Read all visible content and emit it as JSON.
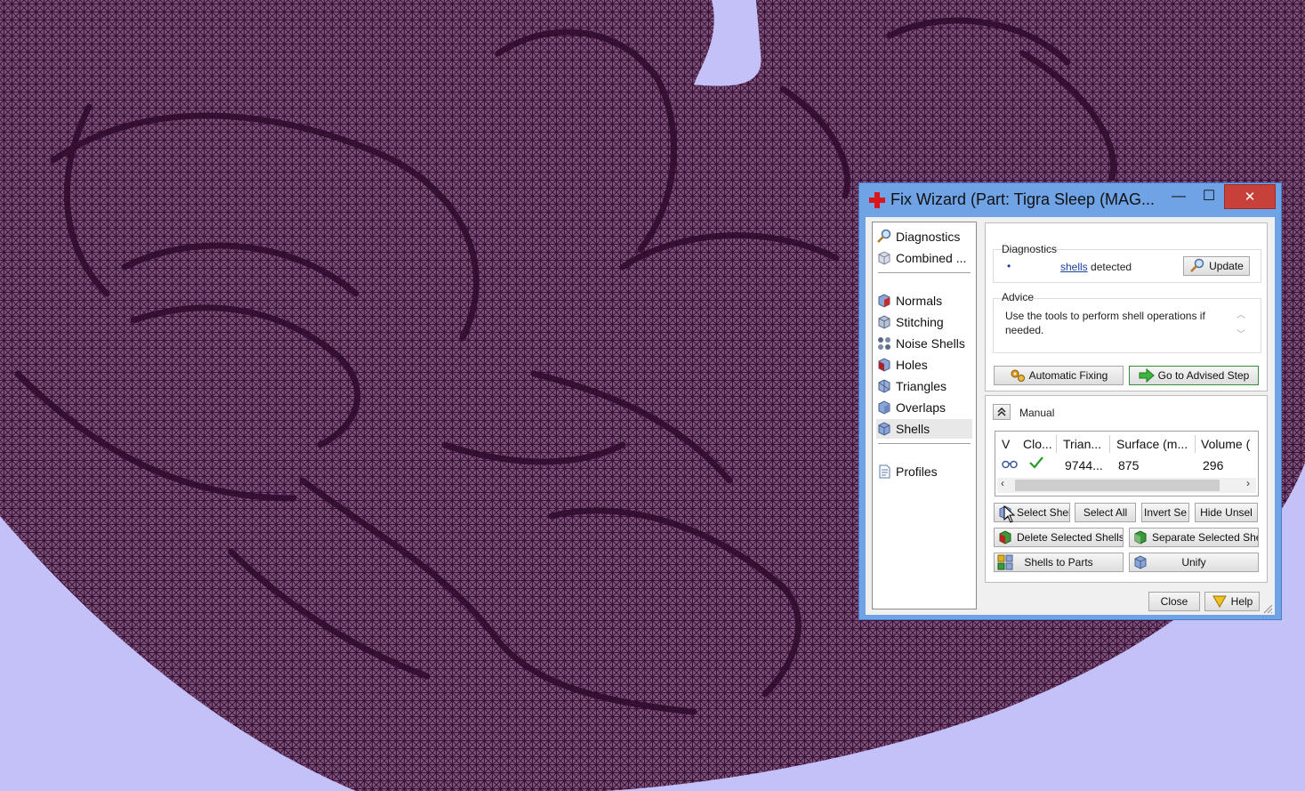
{
  "window": {
    "title": "Fix Wizard (Part: Tigra Sleep (MAG...",
    "minimize_glyph": "—",
    "maximize_glyph": "☐",
    "close_glyph": "✕"
  },
  "nav": {
    "items": [
      {
        "label": "Diagnostics",
        "icon": "magnifier-icon"
      },
      {
        "label": "Combined ...",
        "icon": "cube-icon"
      },
      {
        "label": "Normals",
        "icon": "normals-cube-icon"
      },
      {
        "label": "Stitching",
        "icon": "stitching-cube-icon"
      },
      {
        "label": "Noise Shells",
        "icon": "noise-shells-icon"
      },
      {
        "label": "Holes",
        "icon": "holes-cube-icon"
      },
      {
        "label": "Triangles",
        "icon": "triangles-cube-icon"
      },
      {
        "label": "Overlaps",
        "icon": "overlaps-cube-icon"
      },
      {
        "label": "Shells",
        "icon": "shells-cube-icon"
      },
      {
        "label": "Profiles",
        "icon": "document-icon"
      }
    ],
    "selected": "Shells"
  },
  "diagnostics": {
    "label": "Diagnostics",
    "bullet": "•",
    "link_text": "shells",
    "text": "detected",
    "update_label": "Update"
  },
  "advice": {
    "label": "Advice",
    "text": "Use the tools to perform shell operations if needed."
  },
  "actions": {
    "automatic_fixing": "Automatic Fixing",
    "go_to_advised": "Go to Advised Step"
  },
  "manual": {
    "label": "Manual",
    "columns": [
      "V",
      "Clo...",
      "Trian...",
      "Surface (m...",
      "Volume ("
    ],
    "rows": [
      {
        "triangles": "9744...",
        "surface": "875",
        "volume": "296"
      }
    ],
    "buttons": {
      "select_shells": "Select Shells",
      "select_all": "Select All",
      "invert_sel": "Invert Se",
      "hide_unsel": "Hide Unsel",
      "delete_selected": "Delete Selected Shells",
      "separate_selected": "Separate Selected Shell",
      "shells_to_parts": "Shells to Parts",
      "unify": "Unify"
    }
  },
  "footer": {
    "close": "Close",
    "help": "Help"
  },
  "colors": {
    "mesh": "#4a1a48",
    "background": "#c4c0f8",
    "window_frame": "#6fa3e6"
  }
}
